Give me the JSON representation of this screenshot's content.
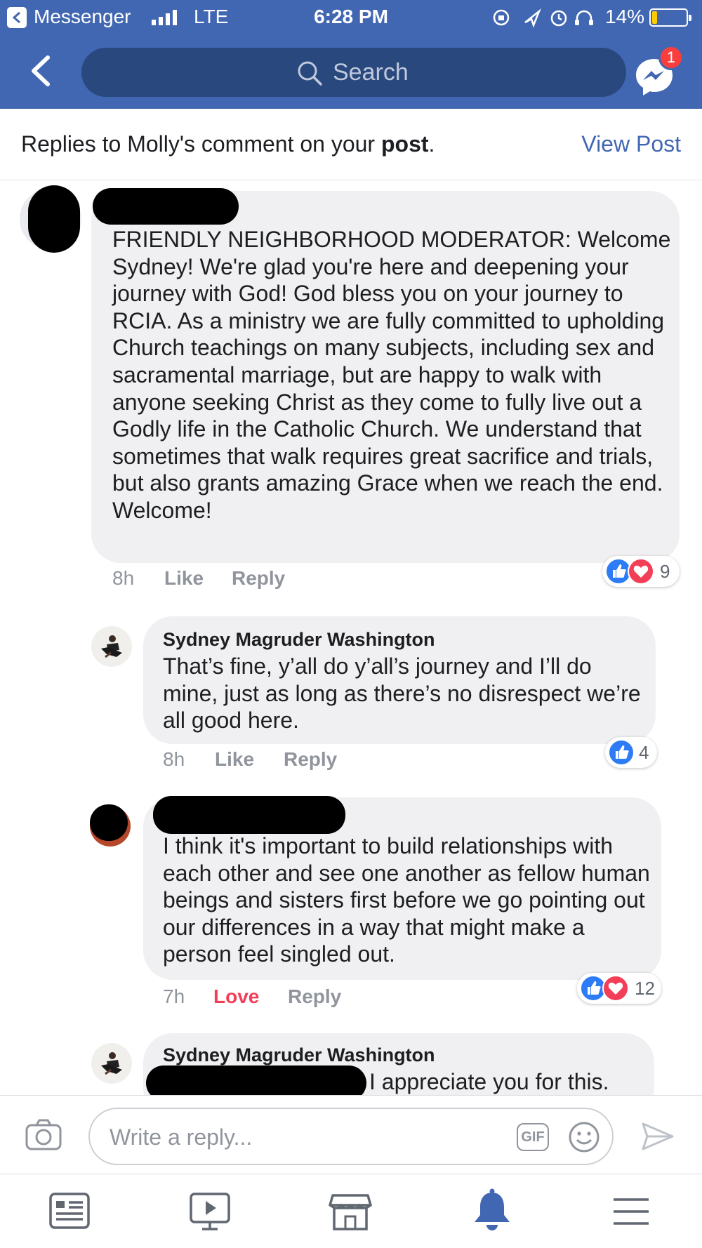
{
  "status_bar": {
    "app": "Messenger",
    "network": "LTE",
    "time": "6:28 PM",
    "battery": "14%",
    "battery_level": 0.14
  },
  "header": {
    "search_placeholder": "Search",
    "messenger_badge": "1"
  },
  "context": {
    "text_before": "Replies to Molly's comment on your ",
    "text_bold": "post",
    "text_after": ".",
    "view_post": "View Post"
  },
  "comments": [
    {
      "author_redacted": true,
      "body": "FRIENDLY NEIGHBORHOOD MODERATOR: Welcome Sydney!  We're glad you're here and deepening your journey with God!  God bless you on your journey to RCIA.  As a ministry we are fully committed to upholding Church teachings on many subjects, including sex and sacramental marriage, but are happy to walk with anyone seeking Christ as they come to fully live out a Godly life in the Catholic Church.  We understand that sometimes that walk requires great sacrifice and trials, but also grants amazing Grace when we reach the end.  Welcome!",
      "time": "8h",
      "like": "Like",
      "reply": "Reply",
      "reactions": [
        "like",
        "love"
      ],
      "reaction_count": "9"
    },
    {
      "author": "Sydney Magruder Washington",
      "body": "That’s fine, y’all do y’all’s journey and I’ll do mine, just as long as there’s no disrespect we’re all good here.",
      "time": "8h",
      "like": "Like",
      "reply": "Reply",
      "reactions": [
        "like"
      ],
      "reaction_count": "4"
    },
    {
      "author_redacted": true,
      "body": "I think it's important to build relationships with each other and see one another as fellow human beings and sisters first before we go pointing out our differences in a way that might make a person feel singled out.",
      "time": "7h",
      "like": "Love",
      "reply": "Reply",
      "reactions": [
        "like",
        "love"
      ],
      "reaction_count": "12"
    },
    {
      "author": "Sydney Magruder Washington",
      "body_visible": "I appreciate you for this."
    }
  ],
  "reply_bar": {
    "placeholder": "Write a reply...",
    "gif": "GIF"
  },
  "tabs": [
    "news-feed",
    "watch",
    "marketplace",
    "notifications",
    "menu"
  ],
  "colors": {
    "header": "#4267b2",
    "search": "#29487d",
    "link": "#4267b2",
    "love": "#f33e58",
    "like": "#2e7bf6",
    "bubble": "#f0f0f2"
  }
}
